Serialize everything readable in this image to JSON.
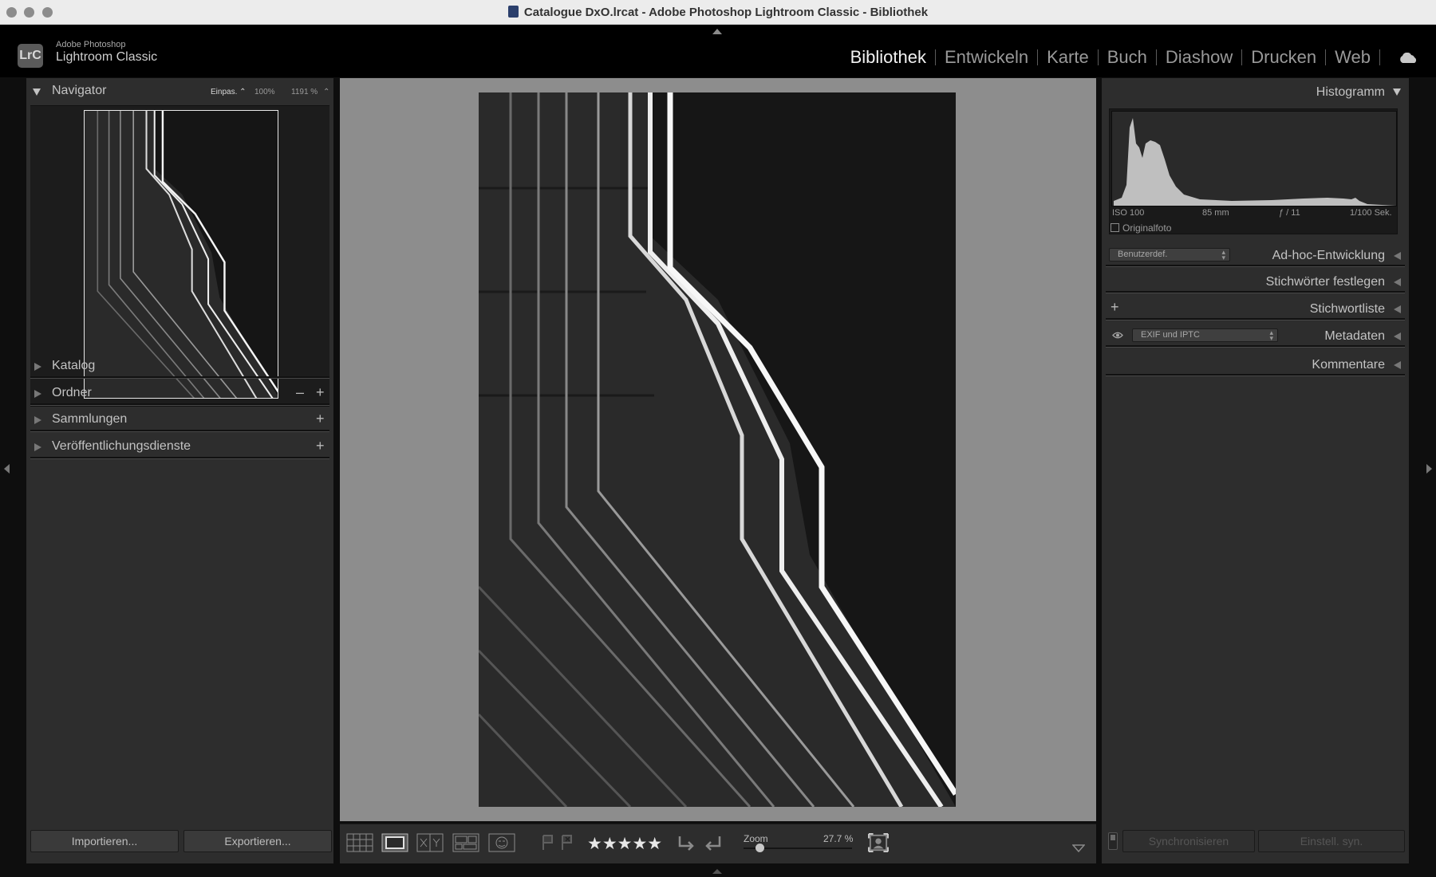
{
  "window": {
    "title": "Catalogue DxO.lrcat - Adobe Photoshop Lightroom Classic - Bibliothek"
  },
  "identity": {
    "badge": "LrC",
    "brand_small": "Adobe Photoshop",
    "brand_big": "Lightroom Classic"
  },
  "modules": [
    {
      "label": "Bibliothek",
      "active": true
    },
    {
      "label": "Entwickeln",
      "active": false
    },
    {
      "label": "Karte",
      "active": false
    },
    {
      "label": "Buch",
      "active": false
    },
    {
      "label": "Diashow",
      "active": false
    },
    {
      "label": "Drucken",
      "active": false
    },
    {
      "label": "Web",
      "active": false
    }
  ],
  "left_panel": {
    "navigator": {
      "title": "Navigator",
      "fit": "Einpas. ⌃",
      "zoom_100": "100%",
      "zoom_custom": "1191 %"
    },
    "sections": [
      "Katalog",
      "Ordner",
      "Sammlungen",
      "Veröffentlichungsdienste"
    ],
    "import_label": "Importieren...",
    "export_label": "Exportieren..."
  },
  "toolbar": {
    "stars": "★★★★★",
    "zoom_label": "Zoom",
    "zoom_value": "27.7 %"
  },
  "right_panel": {
    "histogram": {
      "title": "Histogramm",
      "iso": "ISO 100",
      "focal": "85 mm",
      "aperture": "ƒ / 11",
      "shutter": "1/100 Sek.",
      "original_label": "Originalfoto"
    },
    "adhoc": {
      "title": "Ad-hoc-Entwicklung",
      "preset": "Benutzerdef."
    },
    "keywording_title": "Stichwörter festlegen",
    "keywordlist_title": "Stichwortliste",
    "metadata": {
      "title": "Metadaten",
      "preset": "EXIF und IPTC"
    },
    "comments_title": "Kommentare",
    "sync_label": "Synchronisieren",
    "sync_settings_label": "Einstell. syn."
  }
}
